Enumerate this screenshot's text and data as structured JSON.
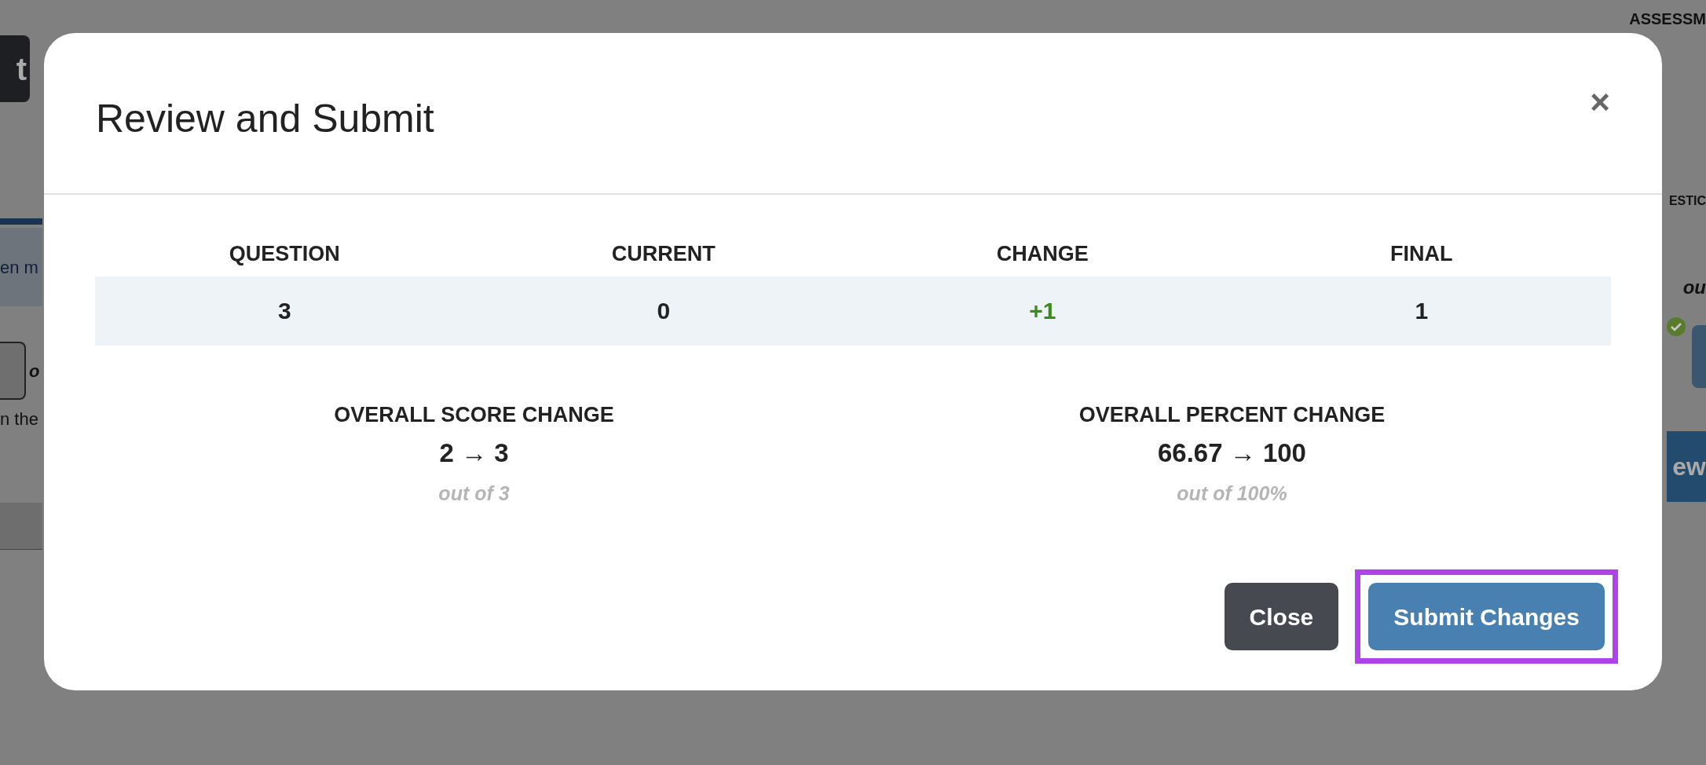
{
  "background": {
    "left": {
      "button": "t",
      "banner": "en m",
      "stepper_label": "o",
      "text": "n the"
    },
    "right": {
      "heading": "ASSESSM",
      "section": "ESTIC",
      "note": "ou",
      "button": "ew"
    }
  },
  "dialog": {
    "title": "Review and Submit",
    "close": "×",
    "table": {
      "columns": [
        "QUESTION",
        "CURRENT",
        "CHANGE",
        "FINAL"
      ],
      "rows": [
        [
          {
            "text": "3",
            "kind": "plain"
          },
          {
            "text": "0",
            "kind": "plain"
          },
          {
            "text": "+1",
            "kind": "delta"
          },
          {
            "text": "1",
            "kind": "plain"
          }
        ]
      ]
    },
    "summaries": [
      {
        "label": "OVERALL SCORE CHANGE",
        "value": "2 → 3",
        "note": "out of 3"
      },
      {
        "label": "OVERALL PERCENT CHANGE",
        "value": "66.67 → 100",
        "note": "out of 100%"
      }
    ],
    "buttons": [
      {
        "label": "Close",
        "kind": "secondary",
        "highlighted": false
      },
      {
        "label": "Submit Changes",
        "kind": "primary",
        "highlighted": true
      }
    ]
  }
}
